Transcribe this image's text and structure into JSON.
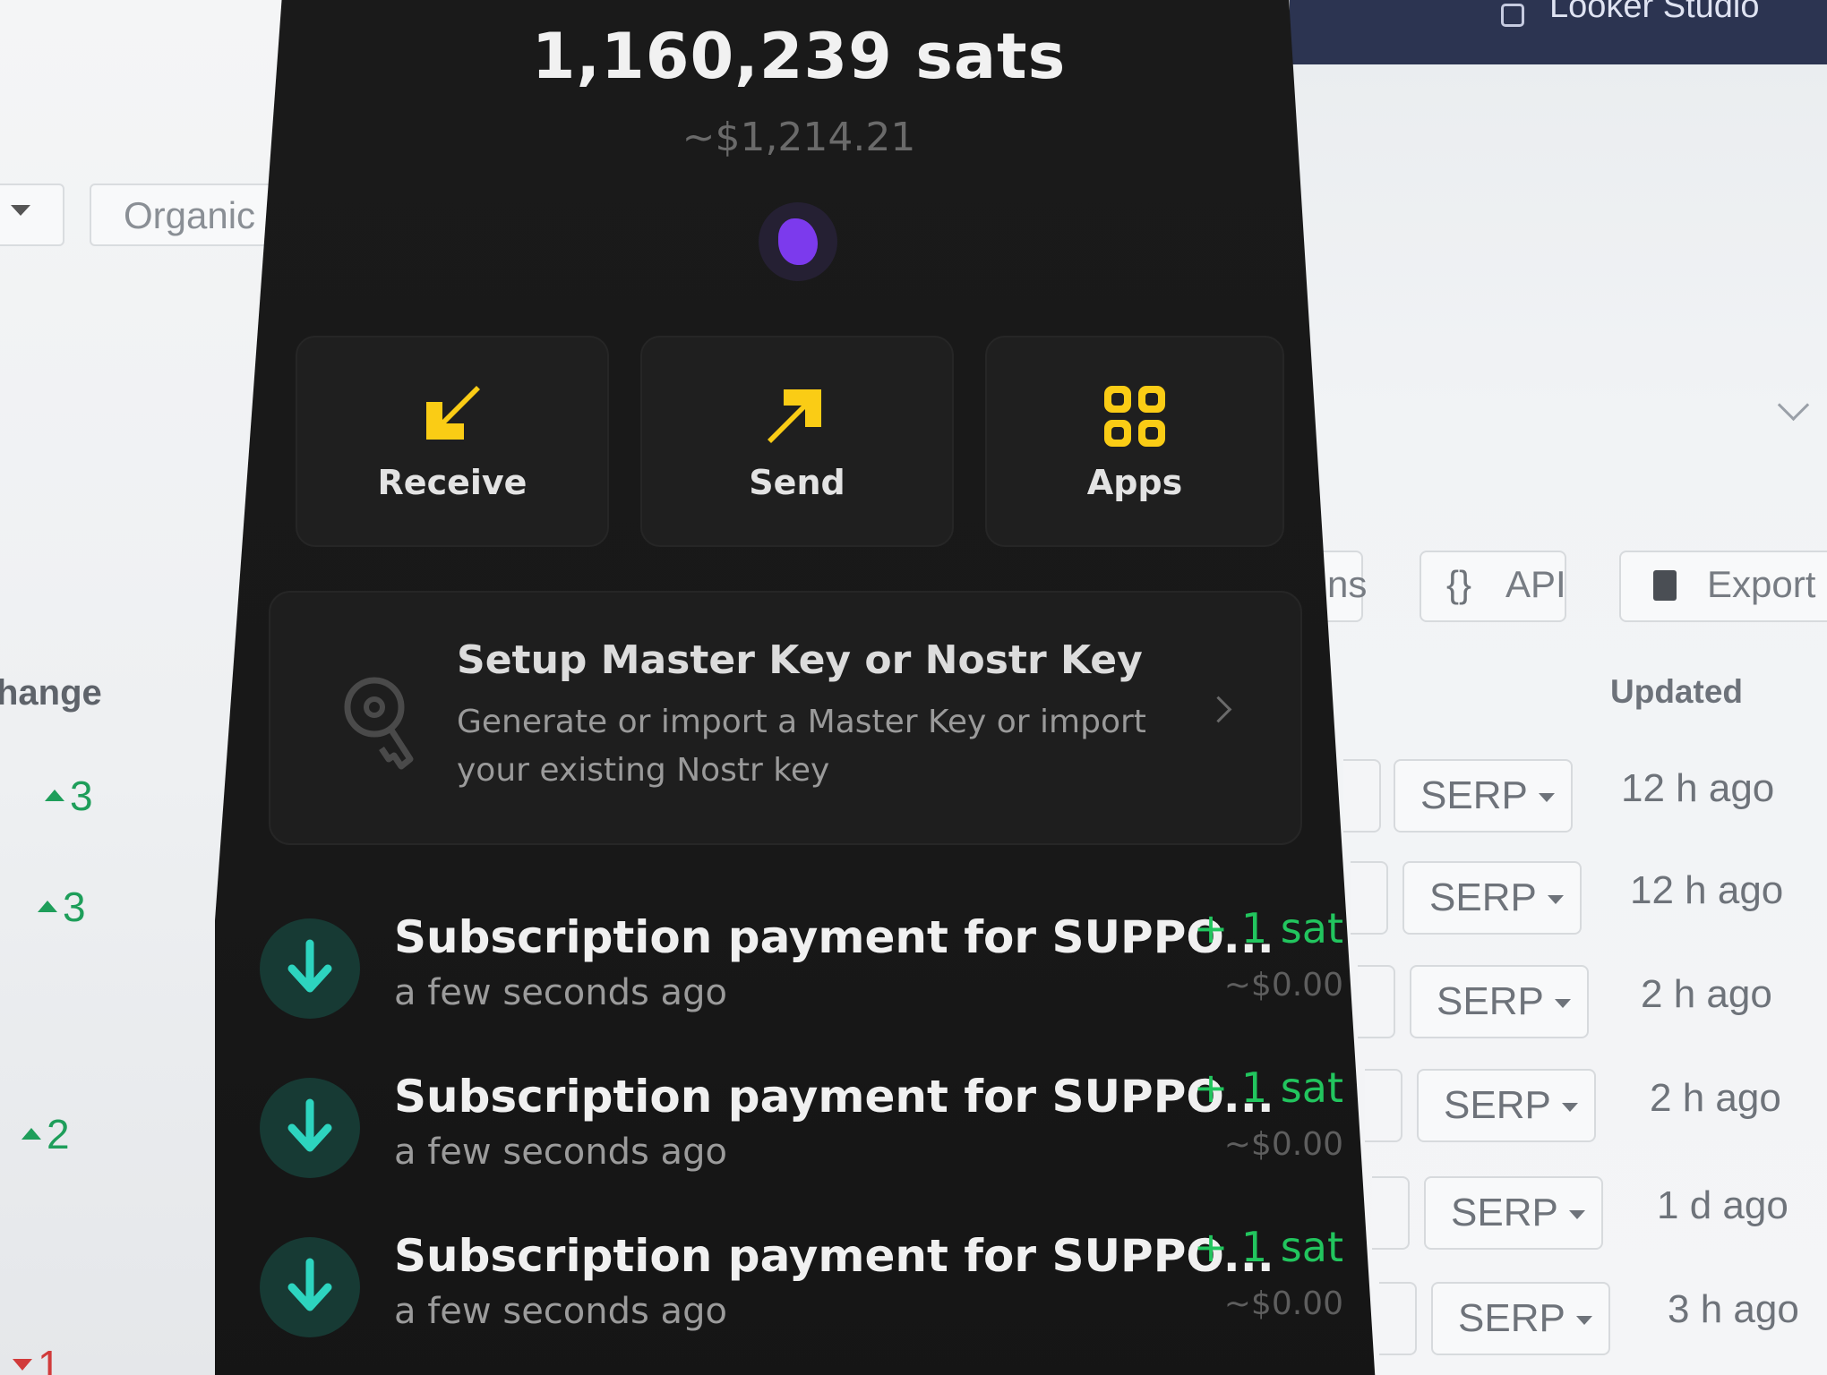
{
  "looker_bar": {
    "title": "Looker Studio"
  },
  "left_panel": {
    "filter_select": {
      "value": "Organic"
    },
    "change_header": "hange",
    "change_values": [
      {
        "value": "3",
        "direction": "up"
      },
      {
        "value": "3",
        "direction": "up"
      },
      {
        "value": "2",
        "direction": "up"
      },
      {
        "value": "1",
        "direction": "down"
      }
    ]
  },
  "right_panel": {
    "toolbar": {
      "partial_label": "ns",
      "api_label": "API",
      "export_label": "Export"
    },
    "updated_header": "Updated",
    "rows": [
      {
        "serp": "SERP",
        "updated": "12 h ago"
      },
      {
        "serp": "SERP",
        "updated": "12 h ago"
      },
      {
        "serp": "SERP",
        "updated": "2 h ago"
      },
      {
        "serp": "SERP",
        "updated": "2 h ago"
      },
      {
        "serp": "SERP",
        "updated": "1 d ago"
      },
      {
        "serp": "SERP",
        "updated": "3 h ago"
      }
    ]
  },
  "wallet": {
    "balance": "1,160,239 sats",
    "fiat": "~$1,214.21",
    "actions": {
      "receive": "Receive",
      "send": "Send",
      "apps": "Apps"
    },
    "setup_card": {
      "title": "Setup Master Key or Nostr Key",
      "description": "Generate or import a Master Key or import your existing Nostr key"
    },
    "transactions": [
      {
        "title": "Subscription payment for SUPPO...",
        "time": "a few seconds ago",
        "amount": "+ 1 sat",
        "fiat": "~$0.00"
      },
      {
        "title": "Subscription payment for SUPPO...",
        "time": "a few seconds ago",
        "amount": "+ 1 sat",
        "fiat": "~$0.00"
      },
      {
        "title": "Subscription payment for SUPPO...",
        "time": "a few seconds ago",
        "amount": "+ 1 sat",
        "fiat": "~$0.00"
      }
    ],
    "colors": {
      "accent_yellow": "#facc15",
      "income_green": "#22c55e",
      "tx_icon_teal": "#2dd4bf",
      "avatar_purple": "#7c3aed"
    },
    "icons": {
      "receive": "arrow-down-left-icon",
      "send": "arrow-up-right-icon",
      "apps": "apps-grid-icon",
      "setup": "key-icon",
      "transaction": "arrow-down-icon"
    }
  }
}
